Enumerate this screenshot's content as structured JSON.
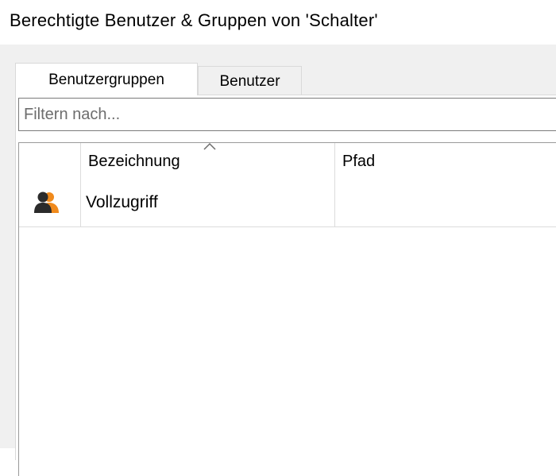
{
  "window": {
    "title": "Berechtigte Benutzer & Gruppen von 'Schalter'"
  },
  "tabs": [
    {
      "label": "Benutzergruppen",
      "active": true
    },
    {
      "label": "Benutzer",
      "active": false
    }
  ],
  "filter": {
    "placeholder": "Filtern nach...",
    "value": ""
  },
  "table": {
    "columns": [
      {
        "label": "",
        "icon": "user-group-icon"
      },
      {
        "label": "Bezeichnung",
        "sorted": "ascending"
      },
      {
        "label": "Pfad"
      }
    ],
    "rows": [
      {
        "icon": "user-group-icon",
        "bezeichnung": "Vollzugriff",
        "pfad": ""
      }
    ]
  },
  "colors": {
    "background": "#f0f0f0",
    "panel": "#ffffff",
    "border": "#d9d9d9",
    "icon_dark": "#2b2b2b",
    "icon_orange": "#f08a1c"
  }
}
